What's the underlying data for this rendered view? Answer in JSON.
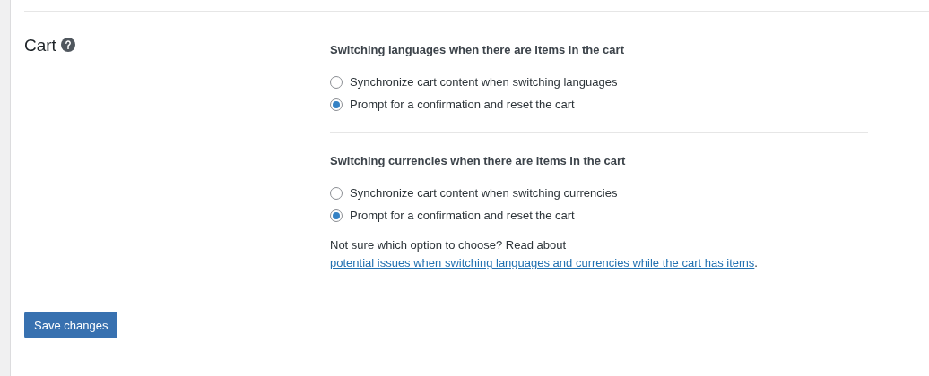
{
  "section": {
    "label": "Cart",
    "groups": [
      {
        "heading": "Switching languages when there are items in the cart",
        "options": [
          {
            "label": "Synchronize cart content when switching languages",
            "selected": false
          },
          {
            "label": "Prompt for a confirmation and reset the cart",
            "selected": true
          }
        ]
      },
      {
        "heading": "Switching currencies when there are items in the cart",
        "options": [
          {
            "label": "Synchronize cart content when switching currencies",
            "selected": false
          },
          {
            "label": "Prompt for a confirmation and reset the cart",
            "selected": true
          }
        ]
      }
    ],
    "note": {
      "text": "Not sure which option to choose? Read about ",
      "link": "potential issues when switching languages and currencies while the cart has items",
      "after": "."
    }
  },
  "buttons": [
    {
      "label": "Save changes"
    }
  ]
}
